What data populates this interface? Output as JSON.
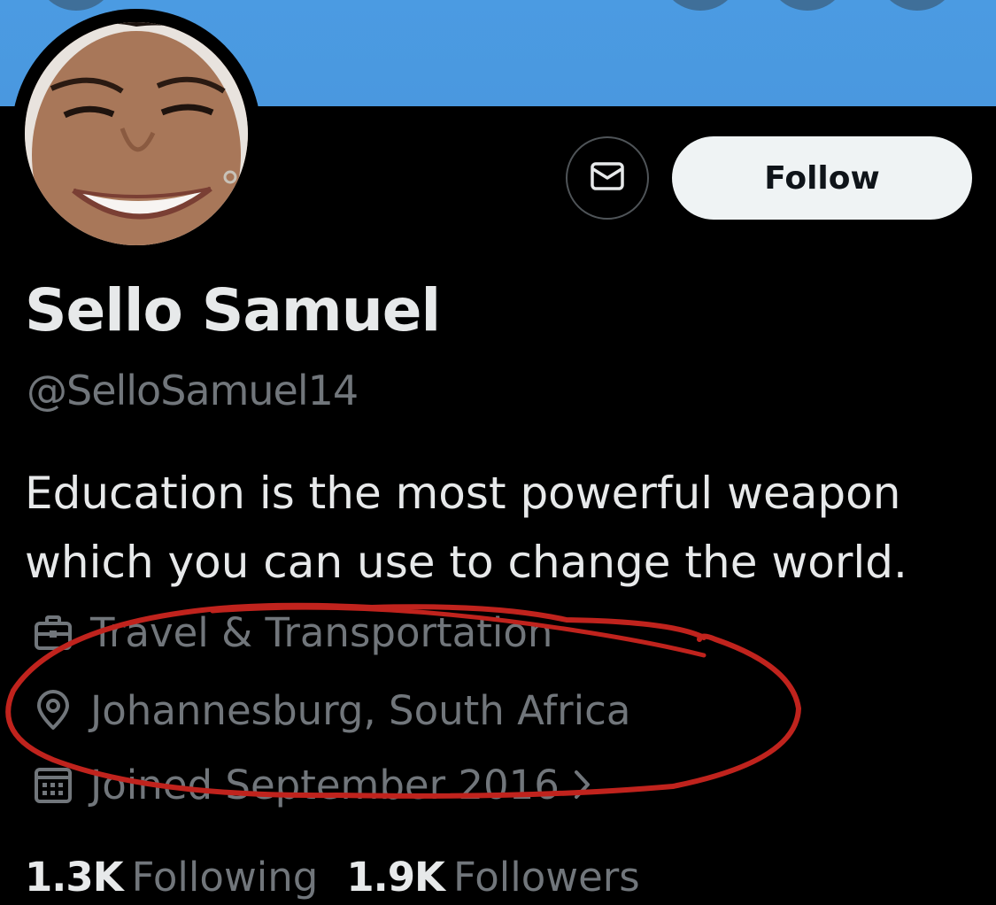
{
  "profile": {
    "display_name": "Sello Samuel",
    "handle": "@SelloSamuel14",
    "bio": "Education is the most powerful weapon which you can use to change the world.",
    "category": "Travel & Transportation",
    "location": "Johannesburg, South Africa",
    "joined": "Joined September 2016"
  },
  "actions": {
    "follow_label": "Follow",
    "message_icon": "envelope-icon"
  },
  "stats": {
    "following_count": "1.3K",
    "following_label": "Following",
    "followers_count": "1.9K",
    "followers_label": "Followers"
  },
  "colors": {
    "banner": "#4b9be2",
    "background": "#000000",
    "primary_text": "#e7e9ea",
    "secondary_text": "#71767b",
    "annotation": "#c0231d"
  }
}
